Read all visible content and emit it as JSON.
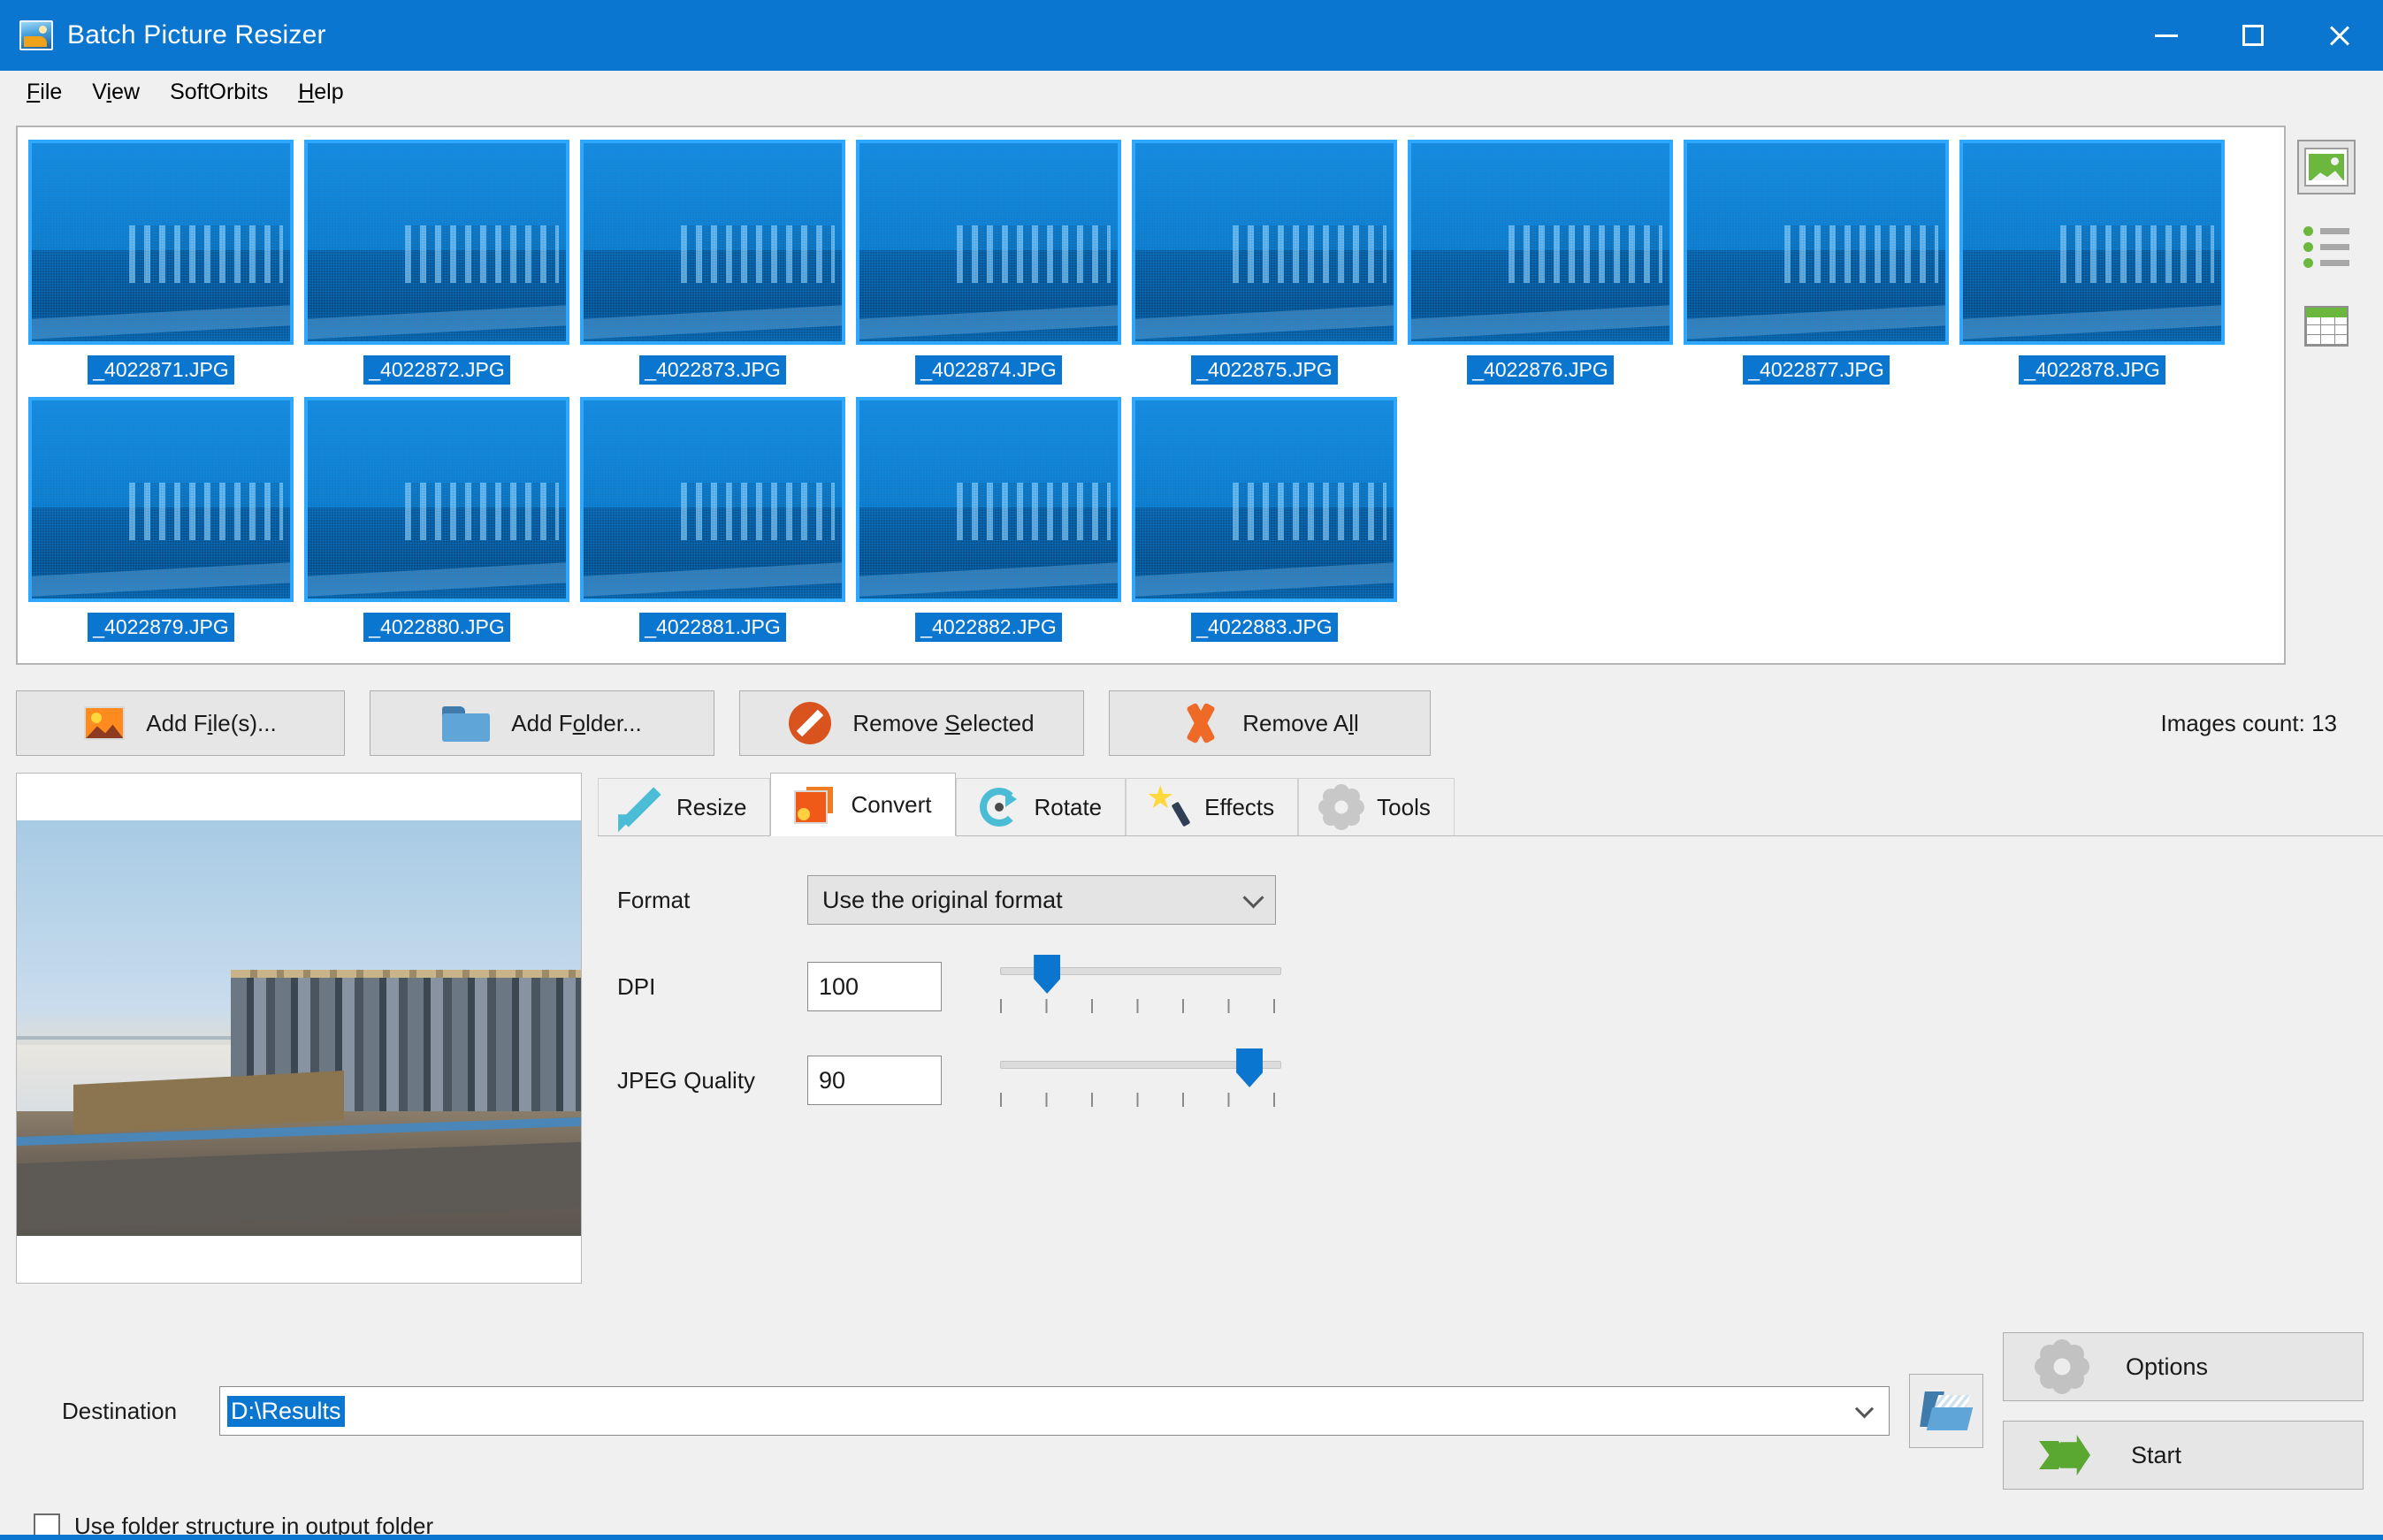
{
  "window": {
    "title": "Batch Picture Resizer",
    "icon": "app-picture-icon",
    "controls": {
      "minimize": "minimize",
      "maximize": "maximize",
      "close": "close"
    }
  },
  "menubar": {
    "items": [
      {
        "label": "File",
        "accel": "F"
      },
      {
        "label": "View",
        "accel": "V"
      },
      {
        "label": "SoftOrbits",
        "accel": ""
      },
      {
        "label": "Help",
        "accel": "H"
      }
    ]
  },
  "thumbnails": {
    "row1": [
      "_4022871.JPG",
      "_4022872.JPG",
      "_4022873.JPG",
      "_4022874.JPG",
      "_4022875.JPG",
      "_4022876.JPG",
      "_4022877.JPG",
      "_4022878.JPG"
    ],
    "row2": [
      "_4022879.JPG",
      "_4022880.JPG",
      "_4022881.JPG",
      "_4022882.JPG",
      "_4022883.JPG"
    ],
    "all_selected": true
  },
  "view_modes": [
    {
      "name": "thumbnail-view",
      "active": true
    },
    {
      "name": "list-view",
      "active": false
    },
    {
      "name": "details-view",
      "active": false
    }
  ],
  "filebar": {
    "add_files": {
      "label_pre": "Add F",
      "accel": "i",
      "label_post": "le(s)..."
    },
    "add_folder": {
      "label_pre": "Add F",
      "accel": "o",
      "label_post": "lder..."
    },
    "remove_selected": {
      "label_pre": "Remove ",
      "accel": "S",
      "label_post": "elected"
    },
    "remove_all": {
      "label_pre": "Remove A",
      "accel": "l",
      "label_post": "l"
    },
    "images_count": "Images count: 13"
  },
  "tabs": [
    {
      "label": "Resize",
      "icon": "resize-icon",
      "active": false
    },
    {
      "label": "Convert",
      "icon": "convert-icon",
      "active": true
    },
    {
      "label": "Rotate",
      "icon": "rotate-icon",
      "active": false
    },
    {
      "label": "Effects",
      "icon": "effects-icon",
      "active": false
    },
    {
      "label": "Tools",
      "icon": "tools-icon",
      "active": false
    }
  ],
  "convert_panel": {
    "format_label": "Format",
    "format_value": "Use the original format",
    "dpi_label": "DPI",
    "dpi_value": "100",
    "dpi_slider_percent": 12,
    "jpeg_label": "JPEG Quality",
    "jpeg_value": "90",
    "jpeg_slider_percent": 84
  },
  "destination": {
    "label": "Destination",
    "value": "D:\\Results",
    "selected": true,
    "browse_icon": "open-folder-icon"
  },
  "options_button": {
    "label": "Options",
    "icon": "gear-icon"
  },
  "start_button": {
    "label": "Start",
    "icon": "green-arrow-icon"
  },
  "folder_structure_checkbox": {
    "label": "Use folder structure in output folder",
    "checked": false
  },
  "colors": {
    "title_blue": "#0b76d0",
    "selection_blue": "#0b76d0",
    "accent_green": "#5aa832",
    "accent_orange": "#ef5a18",
    "window_gray": "#f0f0f0"
  }
}
